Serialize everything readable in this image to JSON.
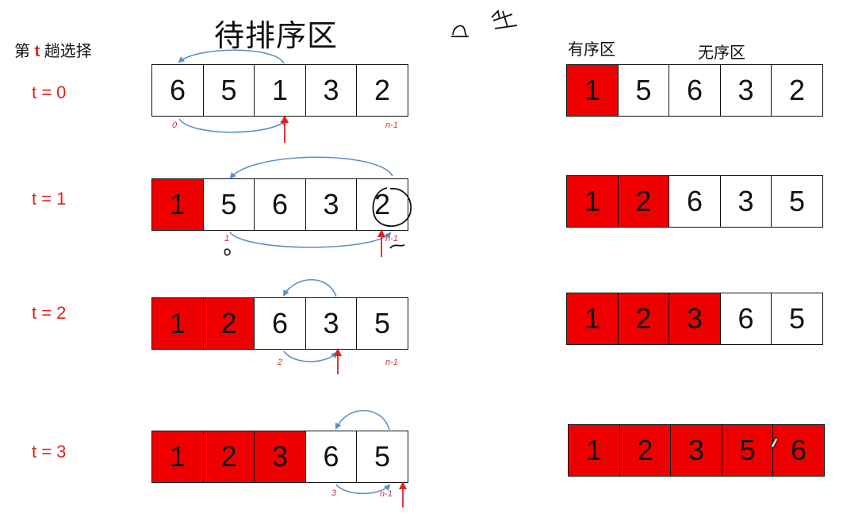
{
  "title": "待排序区",
  "pass_label": {
    "prefix": "第",
    "var": "t",
    "suffix": "趟选择"
  },
  "sorted_label": "有序区",
  "unsorted_label": "无序区",
  "colors": {
    "red": "#ee0000",
    "arrow_blue": "#5b8fc9",
    "pointer_red": "#e02020"
  },
  "rows": [
    {
      "label": "t = 0",
      "left": {
        "values": [
          "6",
          "5",
          "1",
          "3",
          "2"
        ],
        "red": [
          false,
          false,
          false,
          false,
          false
        ]
      },
      "start_index": "0",
      "end_index": "n-1",
      "right": {
        "values": [
          "1",
          "5",
          "6",
          "3",
          "2"
        ],
        "red": [
          true,
          false,
          false,
          false,
          false
        ]
      }
    },
    {
      "label": "t = 1",
      "left": {
        "values": [
          "1",
          "5",
          "6",
          "3",
          "2"
        ],
        "red": [
          true,
          false,
          false,
          false,
          false
        ]
      },
      "start_index": "1",
      "end_index": "n-1",
      "right": {
        "values": [
          "1",
          "2",
          "6",
          "3",
          "5"
        ],
        "red": [
          true,
          true,
          false,
          false,
          false
        ]
      }
    },
    {
      "label": "t = 2",
      "left": {
        "values": [
          "1",
          "2",
          "6",
          "3",
          "5"
        ],
        "red": [
          true,
          true,
          false,
          false,
          false
        ]
      },
      "start_index": "2",
      "end_index": "n-1",
      "right": {
        "values": [
          "1",
          "2",
          "3",
          "6",
          "5"
        ],
        "red": [
          true,
          true,
          true,
          false,
          false
        ]
      }
    },
    {
      "label": "t = 3",
      "left": {
        "values": [
          "1",
          "2",
          "3",
          "6",
          "5"
        ],
        "red": [
          true,
          true,
          true,
          false,
          false
        ]
      },
      "start_index": "3",
      "end_index": "n-1",
      "right": {
        "values": [
          "1",
          "2",
          "3",
          "5",
          "6"
        ],
        "red": [
          true,
          true,
          true,
          true,
          true
        ]
      }
    }
  ]
}
